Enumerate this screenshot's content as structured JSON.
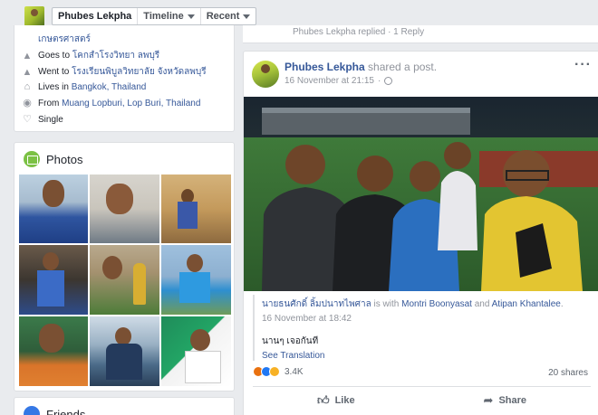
{
  "topbar": {
    "tabs": [
      {
        "label": "Phubes Lekpha"
      },
      {
        "label": "Timeline"
      },
      {
        "label": "Recent"
      }
    ]
  },
  "intro": {
    "cut_off_text": "เกษตรศาสตร์",
    "rows": [
      {
        "icon": "graduation-cap-icon",
        "prefix": "Goes to ",
        "link": "โคกสำโรงวิทยา ลพบุรี"
      },
      {
        "icon": "graduation-cap-icon",
        "prefix": "Went to ",
        "link": "โรงเรียนพิบูลวิทยาลัย จังหวัดลพบุรี"
      },
      {
        "icon": "home-icon",
        "prefix": "Lives in ",
        "link": "Bangkok, Thailand"
      },
      {
        "icon": "map-pin-icon",
        "prefix": "From ",
        "link": "Muang Lopburi, Lop Buri, Thailand"
      },
      {
        "icon": "heart-icon",
        "prefix": "Single",
        "link": ""
      }
    ]
  },
  "photos": {
    "title": "Photos"
  },
  "friends": {
    "title": "Friends"
  },
  "previous_post": {
    "text": "Phubes Lekpha replied · 1 Reply"
  },
  "post": {
    "author": "Phubes Lekpha",
    "action": "shared a post.",
    "time": "16 November at 21:15",
    "shared": {
      "author": "นายธนศักดิ์ ลิ้มปนาทไพศาล",
      "with_text": "is with",
      "tag1": "Montri Boonyasat",
      "and_text": "and",
      "tag2": "Atipan Khantalee",
      "tag_end": ".",
      "time": "16 November at 18:42",
      "text": "นานๆ เจอกันที",
      "translate": "See Translation"
    },
    "reaction_count": "3.4K",
    "shares": "20 shares",
    "like_label": "Like",
    "share_label": "Share"
  },
  "colors": {
    "link": "#365899",
    "background": "#e9ebee"
  }
}
